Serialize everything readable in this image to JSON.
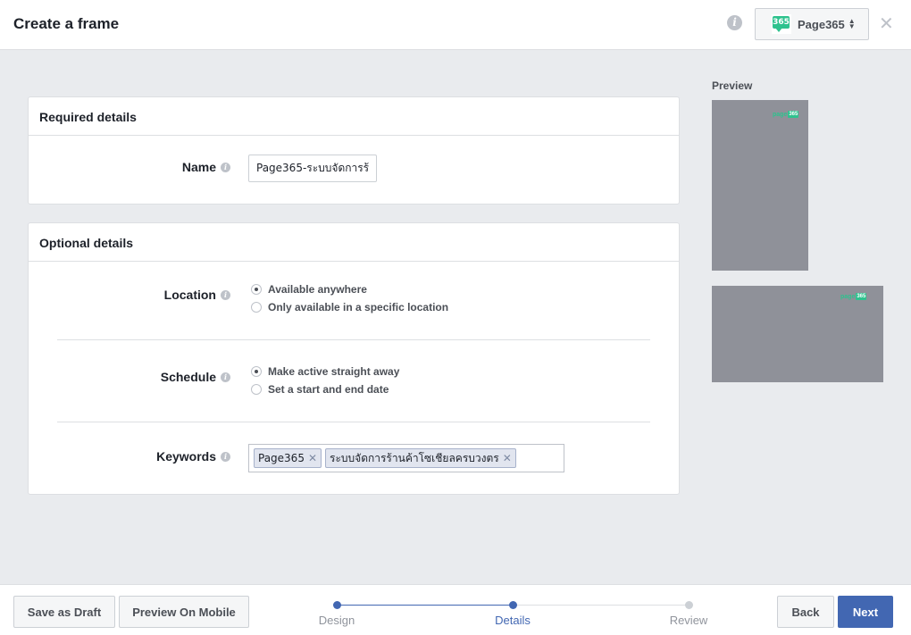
{
  "header": {
    "title": "Create a frame",
    "page_selector": {
      "name": "Page365",
      "logo_text": "365"
    }
  },
  "required": {
    "title": "Required details",
    "name_label": "Name",
    "name_value": "Page365-ระบบจัดการร้"
  },
  "optional": {
    "title": "Optional details",
    "location_label": "Location",
    "location_options": [
      "Available anywhere",
      "Only available in a specific location"
    ],
    "schedule_label": "Schedule",
    "schedule_options": [
      "Make active straight away",
      "Set a start and end date"
    ],
    "keywords_label": "Keywords",
    "keywords": [
      "Page365",
      "ระบบจัดการร้านค้าโซเชียลครบวงตร"
    ]
  },
  "preview": {
    "label": "Preview",
    "logo_text": "page",
    "logo_badge": "365"
  },
  "footer": {
    "save_draft": "Save as Draft",
    "preview_mobile": "Preview On Mobile",
    "steps": [
      "Design",
      "Details",
      "Review"
    ],
    "active_step": "Details",
    "back": "Back",
    "next": "Next"
  },
  "colors": {
    "accent": "#4267b2",
    "brand_green": "#2ec28e",
    "background": "#e9ebee"
  }
}
